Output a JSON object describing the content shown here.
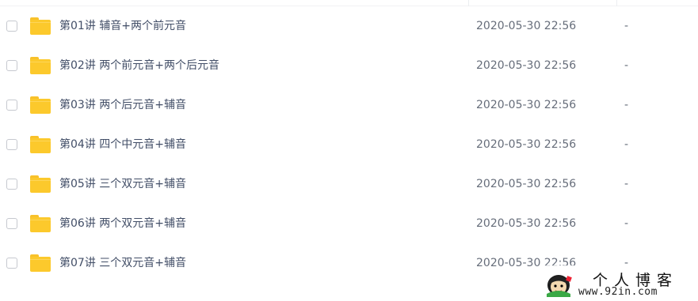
{
  "files": [
    {
      "name": "第01讲 辅音+两个前元音",
      "date": "2020-05-30 22:56",
      "size": "-"
    },
    {
      "name": "第02讲 两个前元音+两个后元音",
      "date": "2020-05-30 22:56",
      "size": "-"
    },
    {
      "name": "第03讲 两个后元音+辅音",
      "date": "2020-05-30 22:56",
      "size": "-"
    },
    {
      "name": "第04讲 四个中元音+辅音",
      "date": "2020-05-30 22:56",
      "size": "-"
    },
    {
      "name": "第05讲 三个双元音+辅音",
      "date": "2020-05-30 22:56",
      "size": "-"
    },
    {
      "name": "第06讲 两个双元音+辅音",
      "date": "2020-05-30 22:56",
      "size": "-"
    },
    {
      "name": "第07讲 三个双元音+辅音",
      "date": "2020-05-30 22:56",
      "size": "-"
    }
  ],
  "watermark": {
    "title": "个人博客",
    "url": "www.92in.com"
  },
  "colors": {
    "folder": "#fcc92c",
    "name_text": "#424e67",
    "meta_text": "#666d7a"
  }
}
